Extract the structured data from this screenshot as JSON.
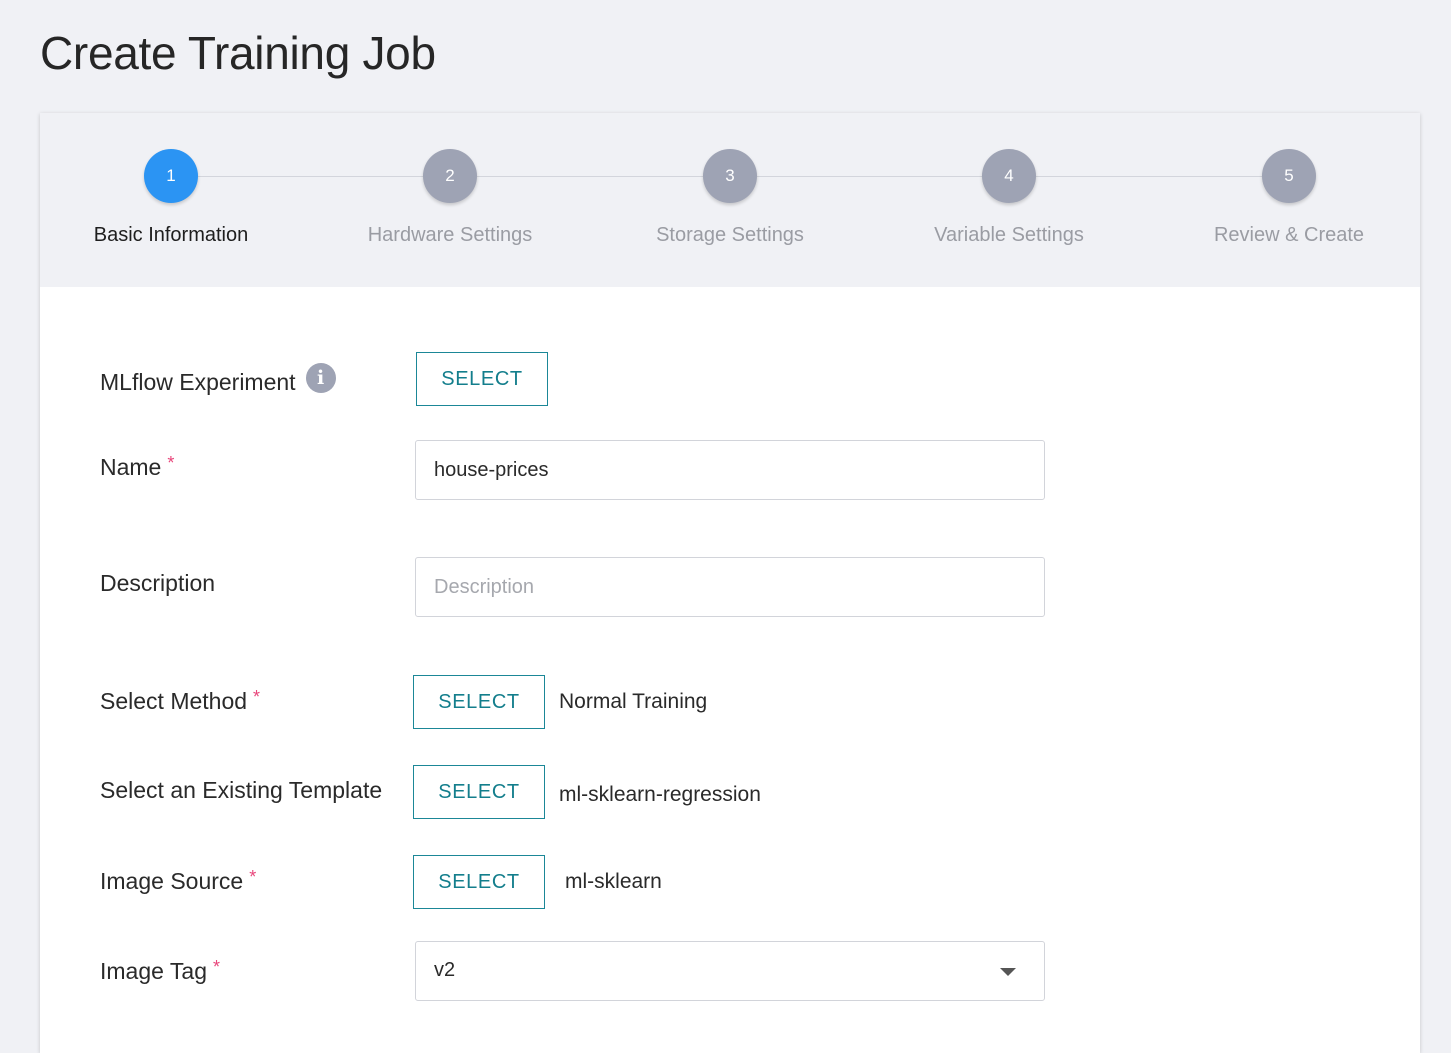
{
  "page_title": "Create Training Job",
  "steps": [
    {
      "number": "1",
      "label": "Basic Information",
      "active": true
    },
    {
      "number": "2",
      "label": "Hardware Settings",
      "active": false
    },
    {
      "number": "3",
      "label": "Storage Settings",
      "active": false
    },
    {
      "number": "4",
      "label": "Variable Settings",
      "active": false
    },
    {
      "number": "5",
      "label": "Review & Create",
      "active": false
    }
  ],
  "form": {
    "mlflow": {
      "label": "MLflow Experiment",
      "button": "SELECT",
      "info_icon": "info-icon"
    },
    "name": {
      "label": "Name",
      "required": "*",
      "value": "house-prices"
    },
    "description": {
      "label": "Description",
      "placeholder": "Description",
      "value": ""
    },
    "method": {
      "label": "Select Method",
      "required": "*",
      "button": "SELECT",
      "value": "Normal Training"
    },
    "template": {
      "label": "Select an Existing Template",
      "button": "SELECT",
      "value": "ml-sklearn-regression"
    },
    "image_source": {
      "label": "Image Source",
      "required": "*",
      "button": "SELECT",
      "value": "ml-sklearn"
    },
    "image_tag": {
      "label": "Image Tag",
      "required": "*",
      "value": "v2",
      "caret_icon": "chevron-down-icon"
    }
  },
  "colors": {
    "active_step": "#2b94f3",
    "inactive_step": "#9ea3b4",
    "button_accent": "#137e8c",
    "required": "#e8457a"
  }
}
